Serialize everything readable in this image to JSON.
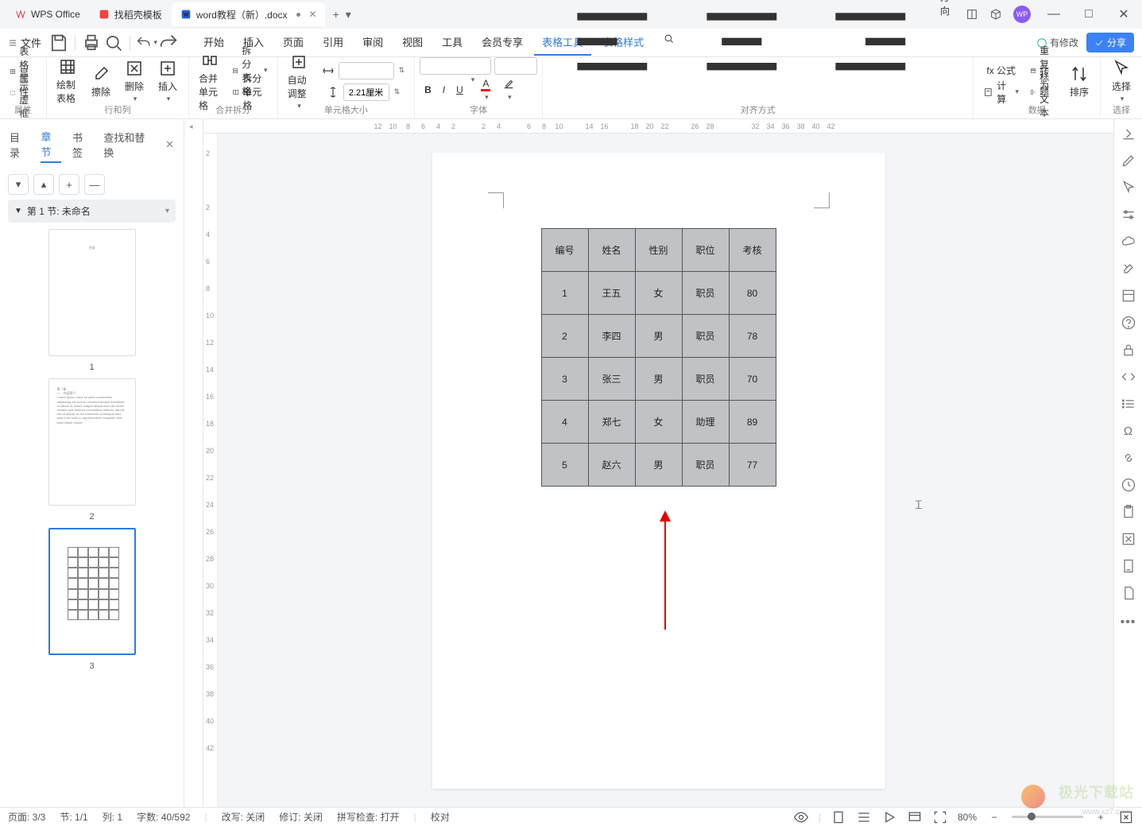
{
  "titlebar": {
    "app": "WPS Office",
    "tab1": "找稻壳模板",
    "tab2": "word教程（新）.docx",
    "newtab_icon": "+",
    "dropdown_icon": "▾"
  },
  "windowctrl": {
    "min": "—",
    "max": "□",
    "close": "✕"
  },
  "menubar": {
    "file": "文件",
    "tabs": [
      "开始",
      "插入",
      "页面",
      "引用",
      "审阅",
      "视图",
      "工具",
      "会员专享",
      "表格工具",
      "表格样式"
    ],
    "active": "表格工具",
    "modify_label": "有修改",
    "share": "分享"
  },
  "ribbon": {
    "g1": {
      "a": "表格属性",
      "b": "显示虚框",
      "label": "属性"
    },
    "g2": {
      "a": "绘制表格",
      "b": "擦除",
      "c": "删除",
      "d": "插入",
      "label": "行和列"
    },
    "g3": {
      "a": "合并单元格",
      "b": "拆分表格",
      "c": "拆分单元格",
      "label": "合并拆分"
    },
    "g4": {
      "a": "自动调整",
      "w": "",
      "h": "2.21厘米",
      "label": "单元格大小"
    },
    "g5": {
      "font": "",
      "size": "",
      "b": "B",
      "i": "I",
      "u": "U",
      "label": "字体"
    },
    "g6": {
      "a": "文字方向",
      "label": "对齐方式"
    },
    "g7": {
      "a": "fx 公式",
      "b": "计算",
      "c": "重复标题",
      "d": "转为文本",
      "e": "排序",
      "label": "数据"
    },
    "g8": {
      "a": "选择",
      "label": "选择"
    }
  },
  "sidebar": {
    "tabs": [
      "目录",
      "章节",
      "书签",
      "查找和替换"
    ],
    "active": "章节",
    "section": "第 1 节: 未命名",
    "nav": {
      "down": "▾",
      "up": "▴",
      "plus": "+",
      "minus": "—"
    },
    "pages": [
      "1",
      "2",
      "3"
    ]
  },
  "doc": {
    "headers": [
      "编号",
      "姓名",
      "性别",
      "职位",
      "考核"
    ],
    "rows": [
      [
        "1",
        "王五",
        "女",
        "职员",
        "80"
      ],
      [
        "2",
        "李四",
        "男",
        "职员",
        "78"
      ],
      [
        "3",
        "张三",
        "男",
        "职员",
        "70"
      ],
      [
        "4",
        "郑七",
        "女",
        "助理",
        "89"
      ],
      [
        "5",
        "赵六",
        "男",
        "职员",
        "77"
      ]
    ]
  },
  "hruler": [
    "12",
    "10",
    "8",
    "6",
    "4",
    "2",
    "",
    "2",
    "4",
    "",
    "6",
    "8",
    "10",
    "",
    "14",
    "16",
    "",
    "18",
    "20",
    "22",
    "",
    "26",
    "28",
    "",
    "",
    "32",
    "34",
    "36",
    "38",
    "40",
    "42"
  ],
  "vruler": [
    "2",
    "",
    "2",
    "4",
    "6",
    "8",
    "10",
    "12",
    "14",
    "16",
    "18",
    "20",
    "22",
    "24",
    "26",
    "28",
    "30",
    "32",
    "34",
    "36",
    "38",
    "40",
    "42"
  ],
  "status": {
    "page": "页面: 3/3",
    "sec": "节: 1/1",
    "col": "列: 1",
    "words": "字数: 40/592",
    "track": "改写: 关闭",
    "rev": "修订: 关闭",
    "spell": "拼写检查: 打开",
    "proof": "校对",
    "zoom": "80%"
  },
  "watermark": {
    "a": "极光下载站",
    "b": "www.xz7.com"
  }
}
